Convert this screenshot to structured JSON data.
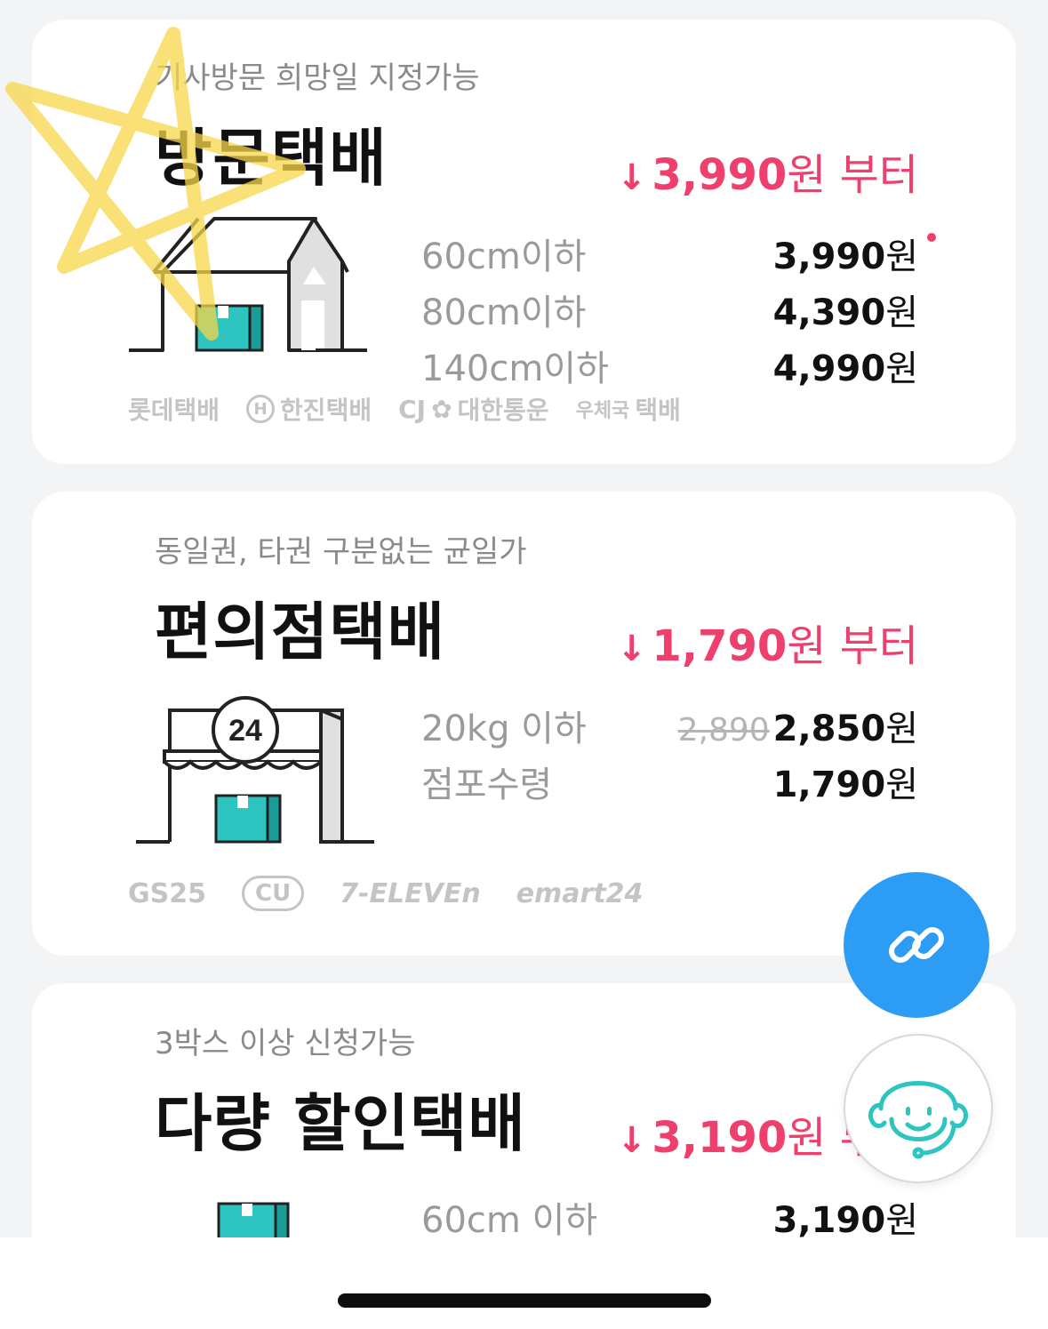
{
  "cards": [
    {
      "subtitle": "기사방문 희망일 지정가능",
      "title": "방문택배",
      "from_price": {
        "arrow": "↓",
        "amount": "3,990",
        "suffix": "원 부터"
      },
      "rows": [
        {
          "label": "60cm이하",
          "value": "3,990",
          "unit": "원"
        },
        {
          "label": "80cm이하",
          "value": "4,390",
          "unit": "원"
        },
        {
          "label": "140cm이하",
          "value": "4,990",
          "unit": "원"
        }
      ],
      "brands": [
        "롯데택배",
        "한진택배",
        "CJ",
        "대한통운",
        "우체국",
        "택배"
      ]
    },
    {
      "subtitle": "동일권, 타권 구분없는 균일가",
      "title": "편의점택배",
      "from_price": {
        "arrow": "↓",
        "amount": "1,790",
        "suffix": "원 부터"
      },
      "rows": [
        {
          "label": "20kg 이하",
          "original": "2,890",
          "value": "2,850",
          "unit": "원"
        },
        {
          "label": "점포수령",
          "value": "1,790",
          "unit": "원"
        }
      ],
      "store_sign": "24",
      "brands": [
        "GS25",
        "CU",
        "7-ELEVEn",
        "emart24"
      ]
    },
    {
      "subtitle": "3박스 이상 신청가능",
      "title": "다량 할인택배",
      "from_price": {
        "arrow": "↓",
        "amount": "3,190",
        "suffix": "원 부터"
      },
      "rows": [
        {
          "label": "60cm 이하",
          "value": "3,190",
          "unit": "원"
        }
      ]
    }
  ],
  "colors": {
    "accent": "#ef3f6c",
    "fab_blue": "#2d9cf5",
    "teal": "#2ec4c0",
    "star_yellow": "#f7d54a"
  },
  "icons": {
    "link_button": "link-icon",
    "help_button": "customer-support-headset-icon"
  }
}
